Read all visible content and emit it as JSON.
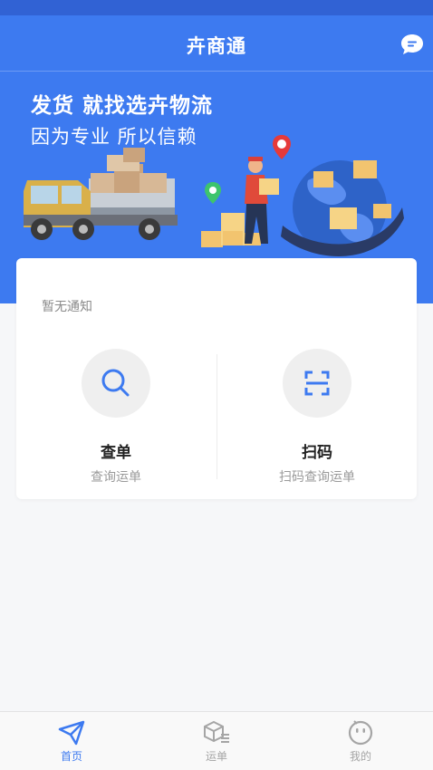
{
  "nav": {
    "title": "卉商通",
    "message_icon": "chat-bubble-icon"
  },
  "hero": {
    "line1": "发货  就找选卉物流",
    "line2": "因为专业  所以信赖"
  },
  "card": {
    "notice": "暂无通知",
    "actions": [
      {
        "title": "查单",
        "subtitle": "查询运单",
        "icon": "search-icon"
      },
      {
        "title": "扫码",
        "subtitle": "扫码查询运单",
        "icon": "scan-icon"
      }
    ]
  },
  "tabs": [
    {
      "label": "首页",
      "icon": "paper-plane-icon",
      "active": true
    },
    {
      "label": "运单",
      "icon": "package-list-icon",
      "active": false
    },
    {
      "label": "我的",
      "icon": "face-icon",
      "active": false
    }
  ],
  "colors": {
    "primary": "#3d7af0",
    "status_bar": "#3162d4",
    "page_bg": "#f6f7f9"
  }
}
